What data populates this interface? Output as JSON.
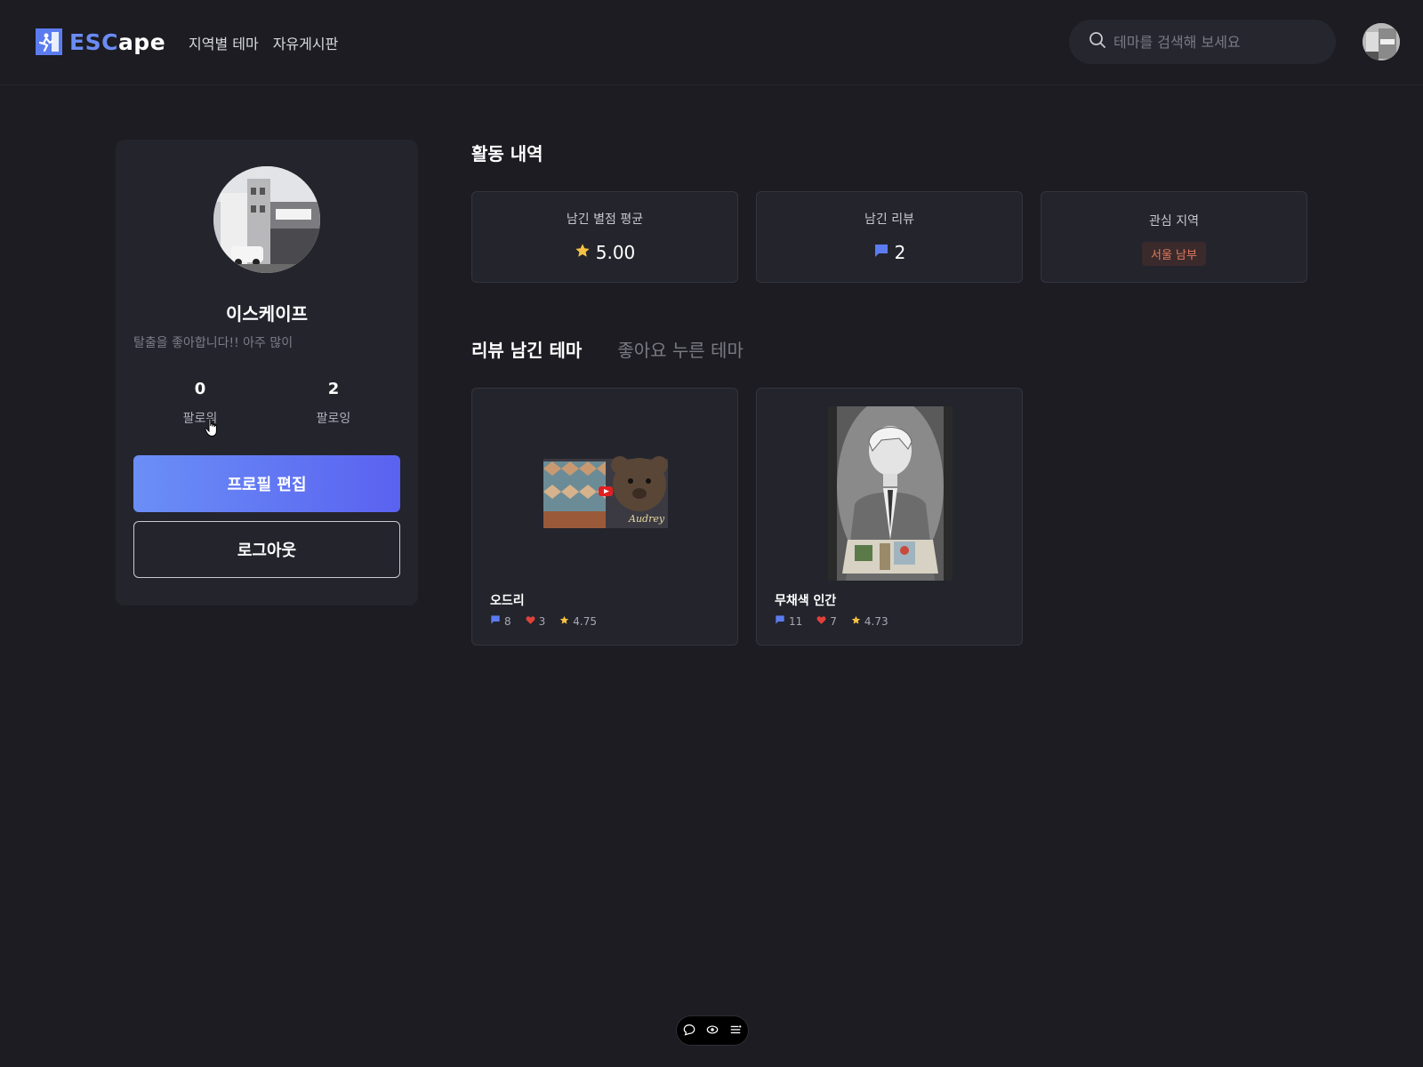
{
  "header": {
    "logo_text_a": "ESC",
    "logo_text_b": "ape",
    "nav": [
      "지역별 테마",
      "자유게시판"
    ],
    "search_placeholder": "테마를 검색해 보세요"
  },
  "profile": {
    "username": "이스케이프",
    "bio": "탈출을 좋아합니다!! 아주 많이",
    "follower_count": "0",
    "follower_label": "팔로워",
    "following_count": "2",
    "following_label": "팔로잉",
    "edit_button": "프로필 편집",
    "logout_button": "로그아웃"
  },
  "activity": {
    "title": "활동 내역",
    "avg_rating_label": "남긴 별점 평균",
    "avg_rating_value": "5.00",
    "reviews_label": "남긴 리뷰",
    "reviews_value": "2",
    "region_label": "관심 지역",
    "region_value": "서울 남부"
  },
  "tabs": {
    "reviewed": "리뷰 남긴 테마",
    "liked": "좋아요 누른 테마"
  },
  "themes": [
    {
      "name": "오드리",
      "comments": "8",
      "likes": "3",
      "rating": "4.75"
    },
    {
      "name": "무채색 인간",
      "comments": "11",
      "likes": "7",
      "rating": "4.73"
    }
  ],
  "colors": {
    "accent": "#5b7cf0",
    "star": "#f5c242",
    "heart": "#e0423a",
    "badge_text": "#e07a5f"
  },
  "icons": [
    "search-icon",
    "star-icon",
    "comment-icon",
    "heart-icon",
    "chat-icon",
    "eye-icon",
    "menu-icon",
    "pointer-cursor-icon"
  ]
}
